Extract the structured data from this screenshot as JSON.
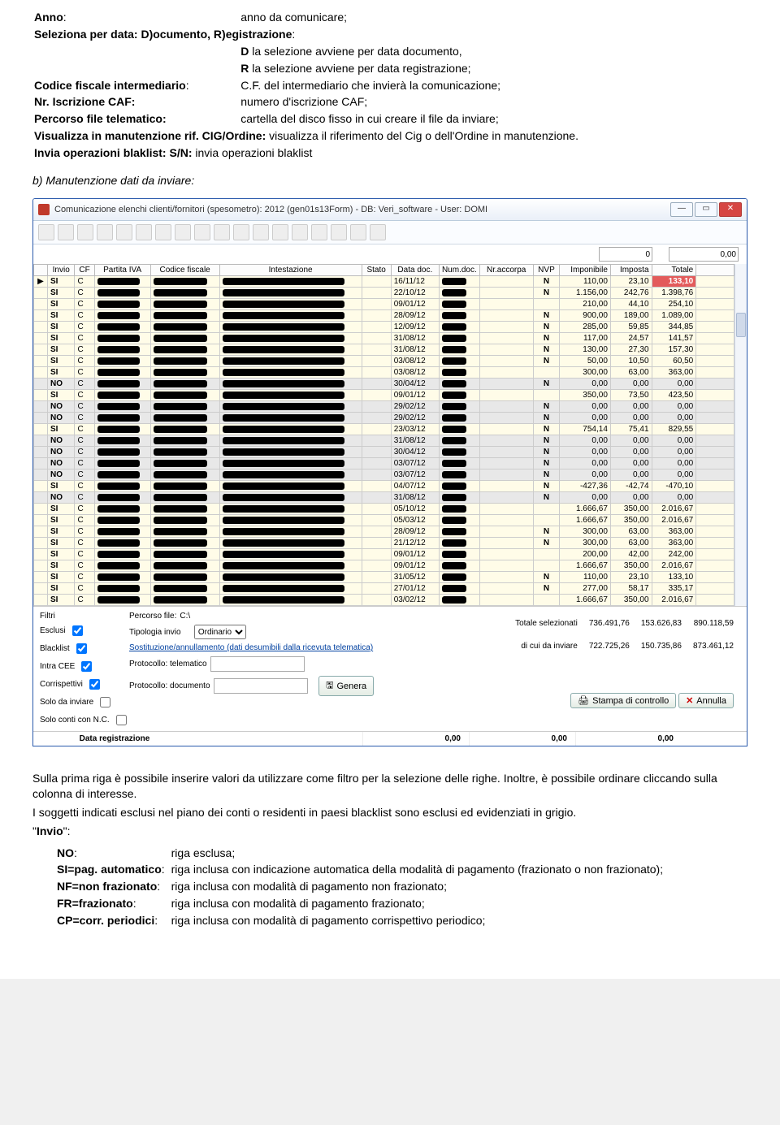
{
  "defs": {
    "anno_l": "Anno",
    "anno_v": "anno da comunicare;",
    "sel_l": "Seleziona per data: D)ocumento, R)egistrazione",
    "sel_d": "D",
    "sel_dv": "la selezione avviene per data documento,",
    "sel_r": "R",
    "sel_rv": "la selezione avviene per data registrazione;",
    "cf_l": "Codice fiscale intermediario",
    "cf_v": "C.F. del intermediario che invierà la comunicazione;",
    "caf_l": "Nr. Iscrizione CAF:",
    "caf_v": "numero d'iscrizione CAF;",
    "perc_l": "Percorso file telematico:",
    "perc_v": "cartella del disco fisso in cui creare il file da inviare;",
    "vis_l": "Visualizza in manutenzione rif. CIG/Ordine:",
    "vis_v": "visualizza il riferimento del Cig o dell'Ordine in manutenzione.",
    "inv_l": "Invia operazioni blaklist: S/N:",
    "inv_v": "invia operazioni blaklist"
  },
  "section_b": "b)  Manutenzione dati da inviare:",
  "win": {
    "title": "Comunicazione elenchi clienti/fornitori (spesometro): 2012  (gen01s13Form) - DB: Veri_software - User: DOMI",
    "search_val": "0",
    "sum_val": "0,00",
    "hdr": {
      "inv": "Invio",
      "cf": "CF",
      "piva": "Partita IVA",
      "cfis": "Codice fiscale",
      "intest": "Intestazione",
      "stato": "Stato",
      "datad": "Data doc.",
      "numd": "Num.doc.",
      "nracc": "Nr.accorpa",
      "nvp": "NVP",
      "impon": "Imponibile",
      "impos": "Imposta",
      "tot": "Totale"
    },
    "filters": {
      "hdr": "Filtri",
      "percorso_l": "Percorso file:",
      "percorso_v": "C:\\",
      "esclusi": "Esclusi",
      "blacklist": "Blacklist",
      "intracee": "Intra CEE",
      "corrisp": "Corrispettivi",
      "solo_inv": "Solo da inviare",
      "solo_nc": "Solo conti con N.C.",
      "tipinv_l": "Tipologia invio",
      "tipinv_v": "Ordinario",
      "sost": "Sostituzione/annullamento (dati desumibili dalla ricevuta telematica)",
      "prot_tel_l": "Protocollo: telematico",
      "prot_doc_l": "Protocollo: documento",
      "genera": "Genera",
      "stampa": "Stampa di controllo",
      "annulla": "Annulla"
    },
    "totals": {
      "sel_l": "Totale selezionati",
      "sel_a": "736.491,76",
      "sel_b": "153.626,83",
      "sel_c": "890.118,59",
      "inv_l": "di cui da inviare",
      "inv_a": "722.725,26",
      "inv_b": "150.735,86",
      "inv_c": "873.461,12"
    },
    "status": {
      "label": "Data registrazione",
      "v1": "0,00",
      "v2": "0,00",
      "v3": "0,00"
    }
  },
  "rows": [
    {
      "inv": "SI",
      "cf": "C",
      "d": "16/11/12",
      "nvp": "N",
      "a": "110,00",
      "b": "23,10",
      "t": "133,10",
      "red": true
    },
    {
      "inv": "SI",
      "cf": "C",
      "d": "22/10/12",
      "nvp": "N",
      "a": "1.156,00",
      "b": "242,76",
      "t": "1.398,76"
    },
    {
      "inv": "SI",
      "cf": "C",
      "d": "09/01/12",
      "nvp": "",
      "a": "210,00",
      "b": "44,10",
      "t": "254,10"
    },
    {
      "inv": "SI",
      "cf": "C",
      "d": "28/09/12",
      "nvp": "N",
      "a": "900,00",
      "b": "189,00",
      "t": "1.089,00"
    },
    {
      "inv": "SI",
      "cf": "C",
      "d": "12/09/12",
      "nvp": "N",
      "a": "285,00",
      "b": "59,85",
      "t": "344,85"
    },
    {
      "inv": "SI",
      "cf": "C",
      "d": "31/08/12",
      "nvp": "N",
      "a": "117,00",
      "b": "24,57",
      "t": "141,57"
    },
    {
      "inv": "SI",
      "cf": "C",
      "d": "31/08/12",
      "nvp": "N",
      "a": "130,00",
      "b": "27,30",
      "t": "157,30"
    },
    {
      "inv": "SI",
      "cf": "C",
      "d": "03/08/12",
      "nvp": "N",
      "a": "50,00",
      "b": "10,50",
      "t": "60,50"
    },
    {
      "inv": "SI",
      "cf": "C",
      "d": "03/08/12",
      "nvp": "",
      "a": "300,00",
      "b": "63,00",
      "t": "363,00"
    },
    {
      "inv": "NO",
      "cf": "C",
      "d": "30/04/12",
      "nvp": "N",
      "a": "0,00",
      "b": "0,00",
      "t": "0,00"
    },
    {
      "inv": "SI",
      "cf": "C",
      "d": "09/01/12",
      "nvp": "",
      "a": "350,00",
      "b": "73,50",
      "t": "423,50"
    },
    {
      "inv": "NO",
      "cf": "C",
      "d": "29/02/12",
      "nvp": "N",
      "a": "0,00",
      "b": "0,00",
      "t": "0,00"
    },
    {
      "inv": "NO",
      "cf": "C",
      "d": "29/02/12",
      "nvp": "N",
      "a": "0,00",
      "b": "0,00",
      "t": "0,00"
    },
    {
      "inv": "SI",
      "cf": "C",
      "d": "23/03/12",
      "nvp": "N",
      "a": "754,14",
      "b": "75,41",
      "t": "829,55"
    },
    {
      "inv": "NO",
      "cf": "C",
      "d": "31/08/12",
      "nvp": "N",
      "a": "0,00",
      "b": "0,00",
      "t": "0,00"
    },
    {
      "inv": "NO",
      "cf": "C",
      "d": "30/04/12",
      "nvp": "N",
      "a": "0,00",
      "b": "0,00",
      "t": "0,00"
    },
    {
      "inv": "NO",
      "cf": "C",
      "d": "03/07/12",
      "nvp": "N",
      "a": "0,00",
      "b": "0,00",
      "t": "0,00"
    },
    {
      "inv": "NO",
      "cf": "C",
      "d": "03/07/12",
      "nvp": "N",
      "a": "0,00",
      "b": "0,00",
      "t": "0,00"
    },
    {
      "inv": "SI",
      "cf": "C",
      "d": "04/07/12",
      "nvp": "N",
      "a": "-427,36",
      "b": "-42,74",
      "t": "-470,10"
    },
    {
      "inv": "NO",
      "cf": "C",
      "d": "31/08/12",
      "nvp": "N",
      "a": "0,00",
      "b": "0,00",
      "t": "0,00"
    },
    {
      "inv": "SI",
      "cf": "C",
      "d": "05/10/12",
      "nvp": "",
      "a": "1.666,67",
      "b": "350,00",
      "t": "2.016,67"
    },
    {
      "inv": "SI",
      "cf": "C",
      "d": "05/03/12",
      "nvp": "",
      "a": "1.666,67",
      "b": "350,00",
      "t": "2.016,67"
    },
    {
      "inv": "SI",
      "cf": "C",
      "d": "28/09/12",
      "nvp": "N",
      "a": "300,00",
      "b": "63,00",
      "t": "363,00"
    },
    {
      "inv": "SI",
      "cf": "C",
      "d": "21/12/12",
      "nvp": "N",
      "a": "300,00",
      "b": "63,00",
      "t": "363,00"
    },
    {
      "inv": "SI",
      "cf": "C",
      "d": "09/01/12",
      "nvp": "",
      "a": "200,00",
      "b": "42,00",
      "t": "242,00"
    },
    {
      "inv": "SI",
      "cf": "C",
      "d": "09/01/12",
      "nvp": "",
      "a": "1.666,67",
      "b": "350,00",
      "t": "2.016,67"
    },
    {
      "inv": "SI",
      "cf": "C",
      "d": "31/05/12",
      "nvp": "N",
      "a": "110,00",
      "b": "23,10",
      "t": "133,10"
    },
    {
      "inv": "SI",
      "cf": "C",
      "d": "27/01/12",
      "nvp": "N",
      "a": "277,00",
      "b": "58,17",
      "t": "335,17"
    },
    {
      "inv": "SI",
      "cf": "C",
      "d": "03/02/12",
      "nvp": "",
      "a": "1.666,67",
      "b": "350,00",
      "t": "2.016,67"
    }
  ],
  "after": {
    "p1": "Sulla prima riga è possibile inserire valori da utilizzare come filtro per la selezione delle righe. Inoltre, è possibile ordinare cliccando sulla colonna di interesse.",
    "p2": "I soggetti indicati esclusi nel piano dei conti o residenti in paesi blacklist sono esclusi ed evidenziati in grigio.",
    "invio": "\"Invio\":",
    "leg": {
      "no_l": "NO",
      "no_v": "riga esclusa;",
      "si_l": "SI=pag. automatico",
      "si_v": "riga inclusa con indicazione automatica della modalità di pagamento (frazionato o non frazionato);",
      "nf_l": "NF=non frazionato",
      "nf_v": "riga inclusa con modalità di pagamento non frazionato;",
      "fr_l": "FR=frazionato",
      "fr_v": "riga inclusa con modalità di pagamento frazionato;",
      "cp_l": "CP=corr. periodici",
      "cp_v": "riga inclusa con modalità di pagamento corrispettivo periodico;"
    }
  }
}
